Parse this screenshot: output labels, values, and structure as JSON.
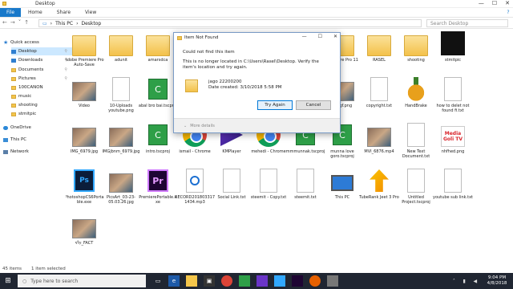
{
  "window": {
    "title": "Desktop",
    "controls": [
      "—",
      "☐",
      "✕"
    ]
  },
  "ribbon": {
    "file": "File",
    "tabs": [
      "Home",
      "Share",
      "View"
    ]
  },
  "address": {
    "path": [
      "This PC",
      "Desktop"
    ],
    "search_placeholder": "Search Desktop"
  },
  "nav": {
    "items": [
      {
        "label": "Quick access",
        "icon": "star"
      },
      {
        "label": "Desktop",
        "icon": "blue",
        "selected": true
      },
      {
        "label": "Downloads",
        "icon": "blue"
      },
      {
        "label": "Documents",
        "icon": "folder"
      },
      {
        "label": "Pictures",
        "icon": "folder"
      },
      {
        "label": "100CANON",
        "icon": "folder"
      },
      {
        "label": "music",
        "icon": "folder"
      },
      {
        "label": "shooting",
        "icon": "folder"
      },
      {
        "label": "stmitpic",
        "icon": "folder"
      },
      {
        "label": "OneDrive",
        "icon": "cloud"
      },
      {
        "label": "This PC",
        "icon": "pc"
      },
      {
        "label": "Network",
        "icon": "net"
      }
    ]
  },
  "files": [
    {
      "label": "Adobe Premiere Pro Auto-Save",
      "kind": "folder"
    },
    {
      "label": "adunit",
      "kind": "folder"
    },
    {
      "label": "amarsdca",
      "kind": "folder"
    },
    {
      "label": "",
      "kind": "none"
    },
    {
      "label": "",
      "kind": "none"
    },
    {
      "label": "",
      "kind": "none"
    },
    {
      "label": "",
      "kind": "none"
    },
    {
      "label": "Premiere Pro 11",
      "kind": "folder"
    },
    {
      "label": "RASEL",
      "kind": "folder"
    },
    {
      "label": "shooting",
      "kind": "folder"
    },
    {
      "label": "stmitpic",
      "kind": "black"
    },
    {
      "label": "",
      "kind": "none"
    },
    {
      "label": "Video",
      "kind": "photo"
    },
    {
      "label": "10-Uploads youtube.png",
      "kind": "doc"
    },
    {
      "label": "abal bro bai.tscproj",
      "kind": "green"
    },
    {
      "label": "",
      "kind": "none"
    },
    {
      "label": "",
      "kind": "none"
    },
    {
      "label": "",
      "kind": "none"
    },
    {
      "label": "",
      "kind": "none"
    },
    {
      "label": "callgf.png",
      "kind": "photo"
    },
    {
      "label": "copyright.txt",
      "kind": "doc"
    },
    {
      "label": "HandBrake",
      "kind": "pine"
    },
    {
      "label": "how to delet not found fi.txt",
      "kind": "doc"
    },
    {
      "label": "",
      "kind": "none"
    },
    {
      "label": "IMG_6979.jpg",
      "kind": "photo"
    },
    {
      "label": "IMGjbnm_6979.jpg",
      "kind": "photo"
    },
    {
      "label": "intro.tscproj",
      "kind": "green"
    },
    {
      "label": "ismail - Chrome",
      "kind": "chrome"
    },
    {
      "label": "KMPlayer",
      "kind": "km"
    },
    {
      "label": "mehedi - Chrome",
      "kind": "chrome"
    },
    {
      "label": "mmmunnak.tscproj",
      "kind": "green"
    },
    {
      "label": "munna love goro.tscproj",
      "kind": "green"
    },
    {
      "label": "MVI_6876.mp4",
      "kind": "photo"
    },
    {
      "label": "New Text Document.txt",
      "kind": "doc"
    },
    {
      "label": "nhfhed.png",
      "kind": "red"
    },
    {
      "label": "",
      "kind": "none"
    },
    {
      "label": "PhotoshopCS6Portable.exe",
      "kind": "ps"
    },
    {
      "label": "PicsArt_03-23-05.03.26.jpg",
      "kind": "photo"
    },
    {
      "label": "PremierePortable.exe",
      "kind": "pr"
    },
    {
      "label": "RECORD2018033171434.mp3",
      "kind": "mp3"
    },
    {
      "label": "Social Link.txt",
      "kind": "doc"
    },
    {
      "label": "steemit - Copy.txt",
      "kind": "doc"
    },
    {
      "label": "steemit.txt",
      "kind": "doc"
    },
    {
      "label": "This PC",
      "kind": "pc"
    },
    {
      "label": "TubeRank Jeet 3 Pro",
      "kind": "arrow"
    },
    {
      "label": "Untitled Project.tscproj",
      "kind": "doc"
    },
    {
      "label": "youtube sub link.txt",
      "kind": "doc"
    },
    {
      "label": "",
      "kind": "none"
    },
    {
      "label": "ষাঁড়_FACT",
      "kind": "photo"
    }
  ],
  "red_thumb_text": "Media Goli TV",
  "doc10_text": "10",
  "dialog": {
    "title": "Item Not Found",
    "msg1": "Could not find this item",
    "msg2": "This is no longer located in C:\\Users\\Rasel\\Desktop. Verify the item's location and try again.",
    "item_name": "jago 22200200",
    "item_date": "Date created: 3/10/2018 5:58 PM",
    "try_again": "Try Again",
    "cancel": "Cancel",
    "more": "More details"
  },
  "status": {
    "count": "45 items",
    "selected": "1 item selected"
  },
  "taskbar": {
    "search": "Type here to search",
    "time": "9:04 PM",
    "date": "4/8/2018"
  }
}
